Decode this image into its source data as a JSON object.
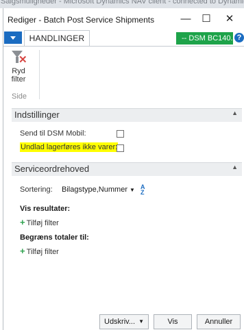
{
  "background_window": {
    "title": "Salgsmuligheder - Microsoft Dynamics NAV client - connected to Dynamics..."
  },
  "window": {
    "title": "Rediger - Batch Post Service Shipments",
    "minimize": "—",
    "maximize": "☐",
    "close": "✕"
  },
  "ribbon": {
    "tab": "HANDLINGER",
    "company": "-- DSM BC140...",
    "help": "?",
    "clear_filter_line1": "Ryd",
    "clear_filter_line2": "filter",
    "group": "Side",
    "clear_filter_icon": "funnel-clear-icon"
  },
  "options": {
    "header": "Indstillinger",
    "send_label": "Send til DSM Mobil:",
    "send_checked": false,
    "exclude_label": "Undlad lagerføres ikke varer:",
    "exclude_checked": false
  },
  "service": {
    "header": "Serviceordrehoved",
    "sort_label": "Sortering:",
    "sort_value": "Bilagstype,Nummer",
    "sort_icon": "sort-az-icon",
    "show_results": "Vis resultater:",
    "add_filter": "Tilføj filter",
    "limit_totals": "Begræns totaler til:",
    "add_filter2": "Tilføj filter"
  },
  "footer": {
    "print": "Udskriv...",
    "show": "Vis",
    "cancel": "Annuller"
  },
  "colors": {
    "accent_blue": "#1b6cc1",
    "company_green": "#1ea34a",
    "highlight": "#ffff00"
  }
}
